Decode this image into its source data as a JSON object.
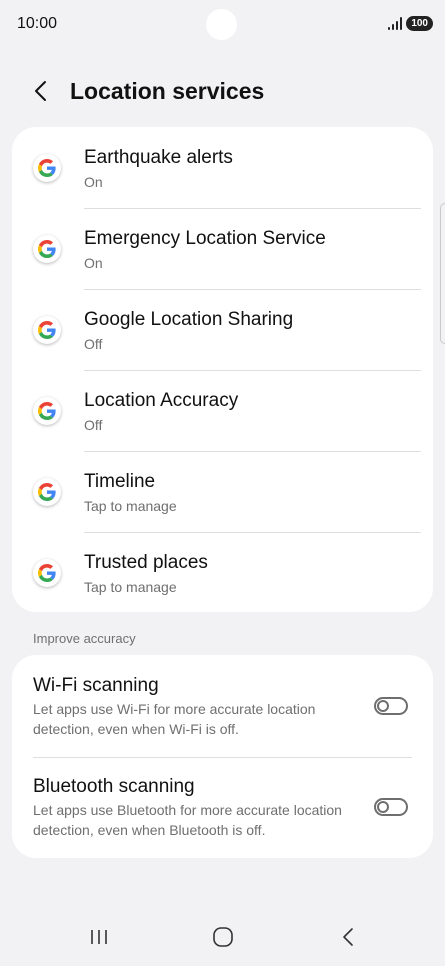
{
  "status_bar": {
    "time": "10:00",
    "battery": "100",
    "signal_icon": "signal-icon"
  },
  "header": {
    "back_icon": "chevron-left-icon",
    "title": "Location services"
  },
  "services": [
    {
      "title": "Earthquake alerts",
      "subtitle": "On",
      "icon": "google-icon"
    },
    {
      "title": "Emergency Location Service",
      "subtitle": "On",
      "icon": "google-icon"
    },
    {
      "title": "Google Location Sharing",
      "subtitle": "Off",
      "icon": "google-icon"
    },
    {
      "title": "Location Accuracy",
      "subtitle": "Off",
      "icon": "google-icon"
    },
    {
      "title": "Timeline",
      "subtitle": "Tap to manage",
      "icon": "google-icon"
    },
    {
      "title": "Trusted places",
      "subtitle": "Tap to manage",
      "icon": "google-icon"
    }
  ],
  "improve_accuracy": {
    "header": "Improve accuracy",
    "items": [
      {
        "title": "Wi-Fi scanning",
        "description": "Let apps use Wi-Fi for more accurate location detection, even when Wi-Fi is off.",
        "enabled": false
      },
      {
        "title": "Bluetooth scanning",
        "description": "Let apps use Bluetooth for more accurate location detection, even when Bluetooth is off.",
        "enabled": false
      }
    ]
  },
  "nav_bar": {
    "recents_icon": "recents-icon",
    "home_icon": "home-icon",
    "back_icon": "back-icon"
  },
  "colors": {
    "background": "#f2f2f4",
    "card": "#ffffff",
    "primary_text": "#111111",
    "secondary_text": "#6f6f6f",
    "toggle_off": "#6e6e6e",
    "google_blue": "#4285F4",
    "google_red": "#EA4335",
    "google_yellow": "#FBBC05",
    "google_green": "#34A853"
  }
}
